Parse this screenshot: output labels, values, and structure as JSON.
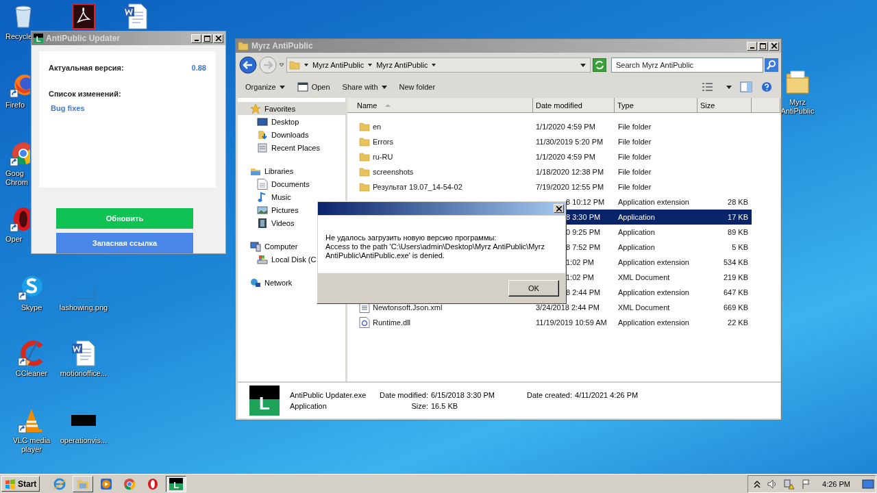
{
  "desktop_icons": [
    {
      "kind": "recycle",
      "label": "Recycle"
    },
    {
      "kind": "acrobat"
    },
    {
      "kind": "word"
    },
    {
      "kind": "firefox",
      "label": "Firefo"
    },
    {
      "kind": "chrome",
      "label": "Goog\nChrom"
    },
    {
      "kind": "opera",
      "label": "Oper"
    },
    {
      "kind": "skype",
      "label": "Skype"
    },
    {
      "kind": "image",
      "label": "lashowing.png"
    },
    {
      "kind": "ccleaner",
      "label": "CCleaner"
    },
    {
      "kind": "word",
      "label": "motionoffice..."
    },
    {
      "kind": "vlc",
      "label": "VLC media\nplayer"
    },
    {
      "kind": "dark-image",
      "label": "operationvis..."
    },
    {
      "kind": "folder",
      "label": "Myrz\nAntiPublic"
    }
  ],
  "updater": {
    "title": "AntiPublic Updater",
    "icon_letter": "L",
    "version_label": "Актуальная версия:",
    "version": "0.88",
    "changes_label": "Список изменений:",
    "changes": "Bug fixes",
    "buttons": [
      {
        "kind": "primary",
        "label": "Обновить"
      },
      {
        "kind": "secondary",
        "label": "Запасная ссылка"
      }
    ]
  },
  "explorer": {
    "title": "Myrz AntiPublic",
    "breadcrumb": [
      "Myrz AntiPublic",
      "Myrz AntiPublic"
    ],
    "search": {
      "placeholder": "Search Myrz AntiPublic"
    },
    "toolbar": [
      {
        "kind": "menu",
        "label": "Organize"
      },
      {
        "kind": "open",
        "label": "Open"
      },
      {
        "kind": "menu",
        "label": "Share with"
      },
      {
        "kind": "plain",
        "label": "New folder"
      }
    ],
    "nav": [
      {
        "kind": "star",
        "label": "Favorites",
        "selected": true,
        "children": [
          {
            "kind": "desktop",
            "label": "Desktop",
            "selected": false
          },
          {
            "kind": "downloads",
            "label": "Downloads",
            "selected": false
          },
          {
            "kind": "recent",
            "label": "Recent Places",
            "selected": false
          }
        ]
      },
      {
        "kind": "library",
        "label": "Libraries",
        "selected": false,
        "children": [
          {
            "kind": "document",
            "label": "Documents",
            "selected": false
          },
          {
            "kind": "music",
            "label": "Music",
            "selected": false
          },
          {
            "kind": "pictures",
            "label": "Pictures",
            "selected": false
          },
          {
            "kind": "videos",
            "label": "Videos",
            "selected": false
          }
        ]
      },
      {
        "kind": "computer",
        "label": "Computer",
        "selected": false,
        "children": [
          {
            "kind": "disk",
            "label": "Local Disk (C",
            "selected": false
          }
        ]
      },
      {
        "kind": "network",
        "label": "Network",
        "selected": false
      }
    ],
    "columns": [
      "Name",
      "Date modified",
      "Type",
      "Size"
    ],
    "rows": [
      {
        "kind": "folder",
        "name": "en",
        "date": "1/1/2020 4:59 PM",
        "type": "File folder",
        "selected": false
      },
      {
        "kind": "folder",
        "name": "Errors",
        "date": "11/30/2019 5:20 PM",
        "type": "File folder",
        "selected": false
      },
      {
        "kind": "folder",
        "name": "ru-RU",
        "date": "1/1/2020 4:59 PM",
        "type": "File folder",
        "selected": false
      },
      {
        "kind": "folder",
        "name": "screenshots",
        "date": "1/18/2020 12:38 PM",
        "type": "File folder",
        "selected": false
      },
      {
        "kind": "folder",
        "name": "Результат 19.07_14-54-02",
        "date": "7/19/2020 12:55 PM",
        "type": "File folder",
        "selected": false
      },
      {
        "date": "8 10:12 PM",
        "type": "Application extension",
        "size": "28 KB",
        "selected": false
      },
      {
        "date": "8 3:30 PM",
        "type": "Application",
        "size": "17 KB",
        "selected": true
      },
      {
        "date": "0 9:25 PM",
        "type": "Application",
        "size": "89 KB",
        "selected": false
      },
      {
        "date": "8 7:52 PM",
        "type": "Application",
        "size": "5 KB",
        "selected": false
      },
      {
        "date": "1:02 PM",
        "type": "Application extension",
        "size": "534 KB",
        "selected": false
      },
      {
        "date": "1:02 PM",
        "type": "XML Document",
        "size": "219 KB",
        "selected": false
      },
      {
        "date": "8 2:44 PM",
        "type": "Application extension",
        "size": "647 KB",
        "selected": false
      },
      {
        "kind": "xml",
        "name": "Newtonsoft.Json.xml",
        "date": "3/24/2018 2:44 PM",
        "type": "XML Document",
        "size": "669 KB",
        "selected": false
      },
      {
        "kind": "dll",
        "name": "Runtime.dll",
        "date": "11/19/2019 10:59 AM",
        "type": "Application extension",
        "size": "22 KB",
        "selected": false
      }
    ],
    "details": {
      "icon_letter": "L",
      "name": "AntiPublic Updater.exe",
      "type": "Application",
      "modified_label": "Date modified:",
      "modified": "6/15/2018 3:30 PM",
      "size_label": "Size:",
      "size": "16.5 KB",
      "created_label": "Date created:",
      "created": "4/11/2021 4:26 PM"
    }
  },
  "dialog": {
    "message": "Не удалось загрузить новую версию программы:\nAccess to the path 'C:\\Users\\admin\\Desktop\\Myrz AntiPublic\\Myrz\nAntiPublic\\AntiPublic.exe' is denied.",
    "button": "OK"
  },
  "taskbar": {
    "start": "Start",
    "items": [
      {
        "kind": "ie",
        "open": false,
        "selected": false
      },
      {
        "kind": "explorer",
        "open": true,
        "selected": false
      },
      {
        "kind": "media",
        "open": false,
        "selected": false
      },
      {
        "kind": "chrome",
        "open": false,
        "selected": false
      },
      {
        "kind": "opera",
        "open": false,
        "selected": false
      },
      {
        "kind": "app",
        "letter": "L",
        "open": true,
        "selected": true
      }
    ],
    "time": "4:26 PM"
  }
}
